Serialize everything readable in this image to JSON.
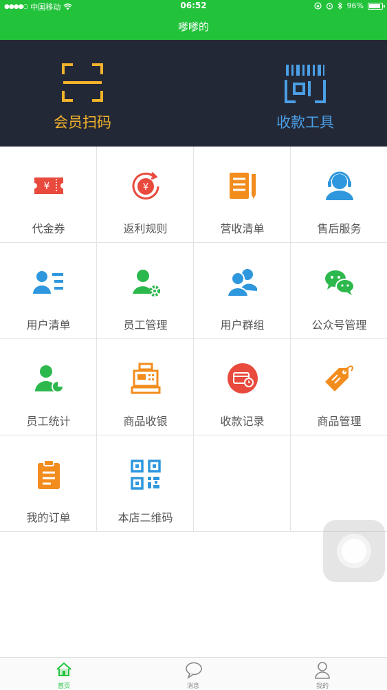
{
  "status_bar": {
    "carrier": "中国移动",
    "time": "06:52",
    "battery_text": "96%",
    "battery_level": 0.96
  },
  "header": {
    "title": "嗲嗲的"
  },
  "hero": [
    {
      "label": "会员扫码",
      "icon": "scan-frame-icon",
      "color": "#f4b32b"
    },
    {
      "label": "收款工具",
      "icon": "barcode-scan-icon",
      "color": "#4a9fe6"
    }
  ],
  "grid_items": [
    {
      "label": "代金券",
      "icon": "coupon-icon",
      "color": "#e84a3d"
    },
    {
      "label": "返利规则",
      "icon": "rebate-yen-icon",
      "color": "#e84a3d"
    },
    {
      "label": "营收清单",
      "icon": "revenue-list-icon",
      "color": "#f28c1d"
    },
    {
      "label": "售后服务",
      "icon": "customer-service-icon",
      "color": "#2e97dd"
    },
    {
      "label": "用户清单",
      "icon": "user-list-icon",
      "color": "#2e97dd"
    },
    {
      "label": "员工管理",
      "icon": "staff-settings-icon",
      "color": "#2db84d"
    },
    {
      "label": "用户群组",
      "icon": "user-group-icon",
      "color": "#2e97dd"
    },
    {
      "label": "公众号管理",
      "icon": "wechat-icon",
      "color": "#2db84d"
    },
    {
      "label": "员工统计",
      "icon": "staff-stats-icon",
      "color": "#2db84d"
    },
    {
      "label": "商品收银",
      "icon": "cash-register-icon",
      "color": "#f28c1d"
    },
    {
      "label": "收款记录",
      "icon": "payment-record-icon",
      "color": "#e84a3d"
    },
    {
      "label": "商品管理",
      "icon": "price-tag-icon",
      "color": "#f28c1d"
    },
    {
      "label": "我的订单",
      "icon": "order-clipboard-icon",
      "color": "#f28c1d"
    },
    {
      "label": "本店二维码",
      "icon": "qr-code-icon",
      "color": "#2e97dd"
    }
  ],
  "tab_bar": [
    {
      "label": "首页",
      "icon": "home-icon",
      "active": true
    },
    {
      "label": "消息",
      "icon": "message-bubble-icon",
      "active": false
    },
    {
      "label": "我的",
      "icon": "person-icon",
      "active": false
    }
  ],
  "colors": {
    "brand_green": "#22c23b",
    "hero_bg": "#232836"
  }
}
